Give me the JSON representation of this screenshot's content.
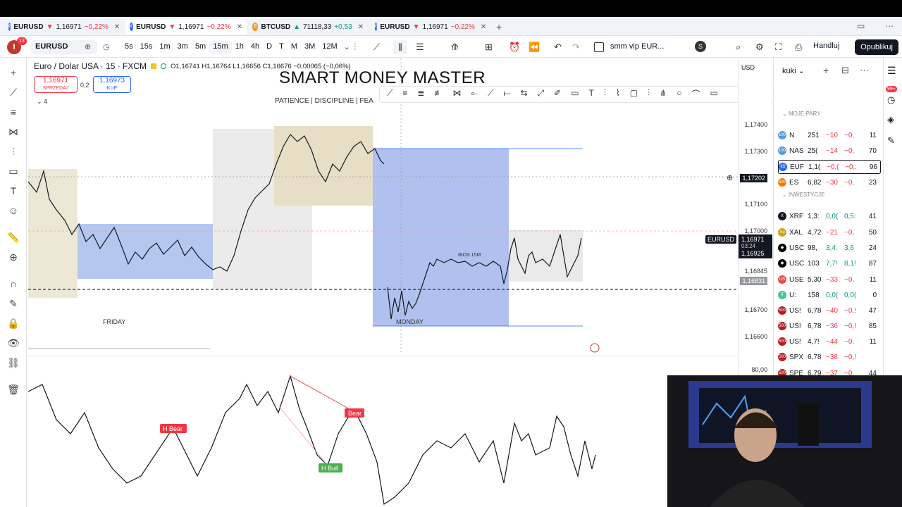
{
  "tabs": [
    {
      "symbol": "EURUSD",
      "arrow": "▼",
      "price": "1,16971",
      "change": "−0,22%",
      "dir": "down"
    },
    {
      "symbol": "EURUSD",
      "arrow": "▼",
      "price": "1,16971",
      "change": "−0,22%",
      "dir": "down"
    },
    {
      "symbol": "BTCUSD",
      "arrow": "▲",
      "price": "71118,33",
      "change": "+0,53",
      "dir": "up"
    },
    {
      "symbol": "EURUSD",
      "arrow": "▼",
      "price": "1,16971",
      "change": "−0,22%",
      "dir": "down"
    }
  ],
  "toolbar": {
    "symbol": "EURUSD",
    "notif_count": "13",
    "timeframes": [
      "5s",
      "15s",
      "1m",
      "3m",
      "5m",
      "15m",
      "1h",
      "4h",
      "D",
      "T",
      "M",
      "3M",
      "12M"
    ],
    "active_tf": "15m",
    "template": "smm vip EUR...",
    "trade": "Handluj",
    "publish": "Opublikuj"
  },
  "legend": {
    "title": "Euro / Dolar USA · 15 · FXCM",
    "ohlc": "O1,16741 H1,16764 L1,16656 C1,16676 −0,00065 (−0,06%)",
    "sell_price": "1,16971",
    "sell_label": "SPRZEDAJ",
    "spread": "0,2",
    "buy_price": "1,16973",
    "buy_label": "KUP",
    "collapse": "4"
  },
  "overlay": {
    "title": "SMART MONEY MASTER",
    "subtitle": "PATIENCE | DISCIPLINE | FEA"
  },
  "chart_labels": {
    "friday": "FRIDAY",
    "monday": "MONDAY",
    "ibos": "IBOS 15M",
    "h_bear": "H Bear",
    "bear": "Bear",
    "h_bull": "H Bull"
  },
  "price_scale": {
    "currency": "USD",
    "ticks": [
      "1,17400",
      "1,17300",
      "1,17202",
      "1,17100",
      "1,17000",
      "1,16845",
      "1,16831",
      "1,16700",
      "1,16600"
    ],
    "cursor_price": "1,17202",
    "symbol_tag": "EURUSD",
    "last_price": "1,16971",
    "countdown": "03:24",
    "price2": "1,16925",
    "osc_tick": "80,00"
  },
  "watchlist": {
    "name": "kuki",
    "section1": "MOJE PARY",
    "section2": "INWESTYCJE",
    "rows": [
      {
        "sym": "N",
        "last": "251",
        "ch": "−10",
        "chp": "−0,",
        "vol": "11",
        "color": "#5b9bd5",
        "icon": "100"
      },
      {
        "sym": "NAS",
        "last": "25(",
        "ch": "−14",
        "chp": "−0,",
        "vol": "70",
        "color": "#5b9bd5",
        "icon": "100"
      },
      {
        "sym": "EUF",
        "last": "1,1(",
        "ch": "−0,(",
        "chp": "−0,:",
        "vol": "96",
        "color": "#2962ff",
        "icon": "€$"
      },
      {
        "sym": "ES",
        "last": "6,82",
        "ch": "−30",
        "chp": "−0,",
        "vol": "23",
        "color": "#f57c00",
        "icon": "500"
      },
      {
        "sym": "XRF",
        "last": "1,3:",
        "ch": "0,0(",
        "chp": "0,5:",
        "vol": "41",
        "color": "#131722",
        "icon": "X"
      },
      {
        "sym": "XAL",
        "last": "4,72",
        "ch": "−21",
        "chp": "−0,",
        "vol": "50",
        "color": "#d4a017",
        "icon": "Au"
      },
      {
        "sym": "USC",
        "last": "98,",
        "ch": "3,4:",
        "chp": "3,6",
        "vol": "24",
        "color": "#000",
        "icon": "◆"
      },
      {
        "sym": "USC",
        "last": "103",
        "ch": "7,7!",
        "chp": "8,1!",
        "vol": "87",
        "color": "#000",
        "icon": "◆"
      },
      {
        "sym": "USE",
        "last": "5,30",
        "ch": "−33",
        "chp": "−0,",
        "vol": "11",
        "color": "#e05050",
        "icon": "US"
      },
      {
        "sym": "U:",
        "last": "158",
        "ch": "0,0(",
        "chp": "0,0(",
        "vol": "0",
        "color": "#4fc3a1",
        "icon": "₮"
      },
      {
        "sym": "US!",
        "last": "6,78",
        "ch": "−40",
        "chp": "−0,!",
        "vol": "47",
        "color": "#b71c1c",
        "icon": "500"
      },
      {
        "sym": "US!",
        "last": "6,78",
        "ch": "−36",
        "chp": "−0,!",
        "vol": "85",
        "color": "#b71c1c",
        "icon": "500"
      },
      {
        "sym": "US!",
        "last": "4,7!",
        "ch": "−44",
        "chp": "−0,",
        "vol": "11",
        "color": "#b71c1c",
        "icon": "500"
      },
      {
        "sym": "SPX",
        "last": "6,78",
        "ch": "−38",
        "chp": "−0,!",
        "vol": "",
        "color": "#b71c1c",
        "icon": "500"
      },
      {
        "sym": "SPE",
        "last": "6,79",
        "ch": "−37",
        "chp": "−0,",
        "vol": "44",
        "color": "#b71c1c",
        "icon": "500"
      }
    ]
  },
  "right_badge": "99+"
}
